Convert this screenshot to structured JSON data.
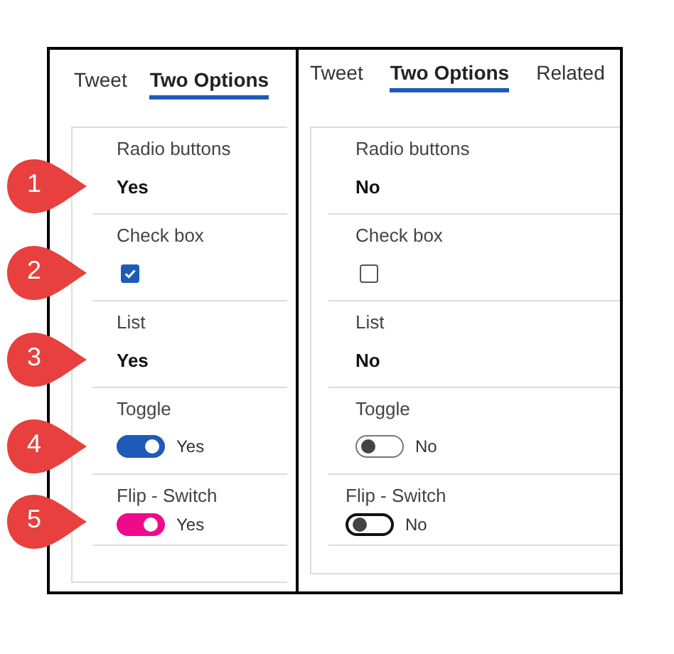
{
  "panels": [
    {
      "tabs": [
        {
          "label": "Tweet",
          "selected": false
        },
        {
          "label": "Two Options",
          "selected": true
        }
      ],
      "fields": [
        {
          "kind": "radio",
          "label": "Radio buttons",
          "value": "Yes",
          "callout": "1"
        },
        {
          "kind": "checkbox",
          "label": "Check box",
          "checked": true,
          "callout": "2"
        },
        {
          "kind": "list",
          "label": "List",
          "value": "Yes",
          "callout": "3"
        },
        {
          "kind": "toggle",
          "label": "Toggle",
          "on": true,
          "value": "Yes",
          "callout": "4"
        },
        {
          "kind": "flip",
          "label": "Flip - Switch",
          "on": true,
          "value": "Yes",
          "callout": "5"
        }
      ]
    },
    {
      "tabs": [
        {
          "label": "Tweet",
          "selected": false
        },
        {
          "label": "Two Options",
          "selected": true
        },
        {
          "label": "Related",
          "selected": false
        }
      ],
      "fields": [
        {
          "kind": "radio",
          "label": "Radio buttons",
          "value": "No"
        },
        {
          "kind": "checkbox",
          "label": "Check box",
          "checked": false
        },
        {
          "kind": "list",
          "label": "List",
          "value": "No"
        },
        {
          "kind": "toggle",
          "label": "Toggle",
          "on": false,
          "value": "No"
        },
        {
          "kind": "flip",
          "label": "Flip - Switch",
          "on": false,
          "value": "No"
        }
      ]
    }
  ]
}
